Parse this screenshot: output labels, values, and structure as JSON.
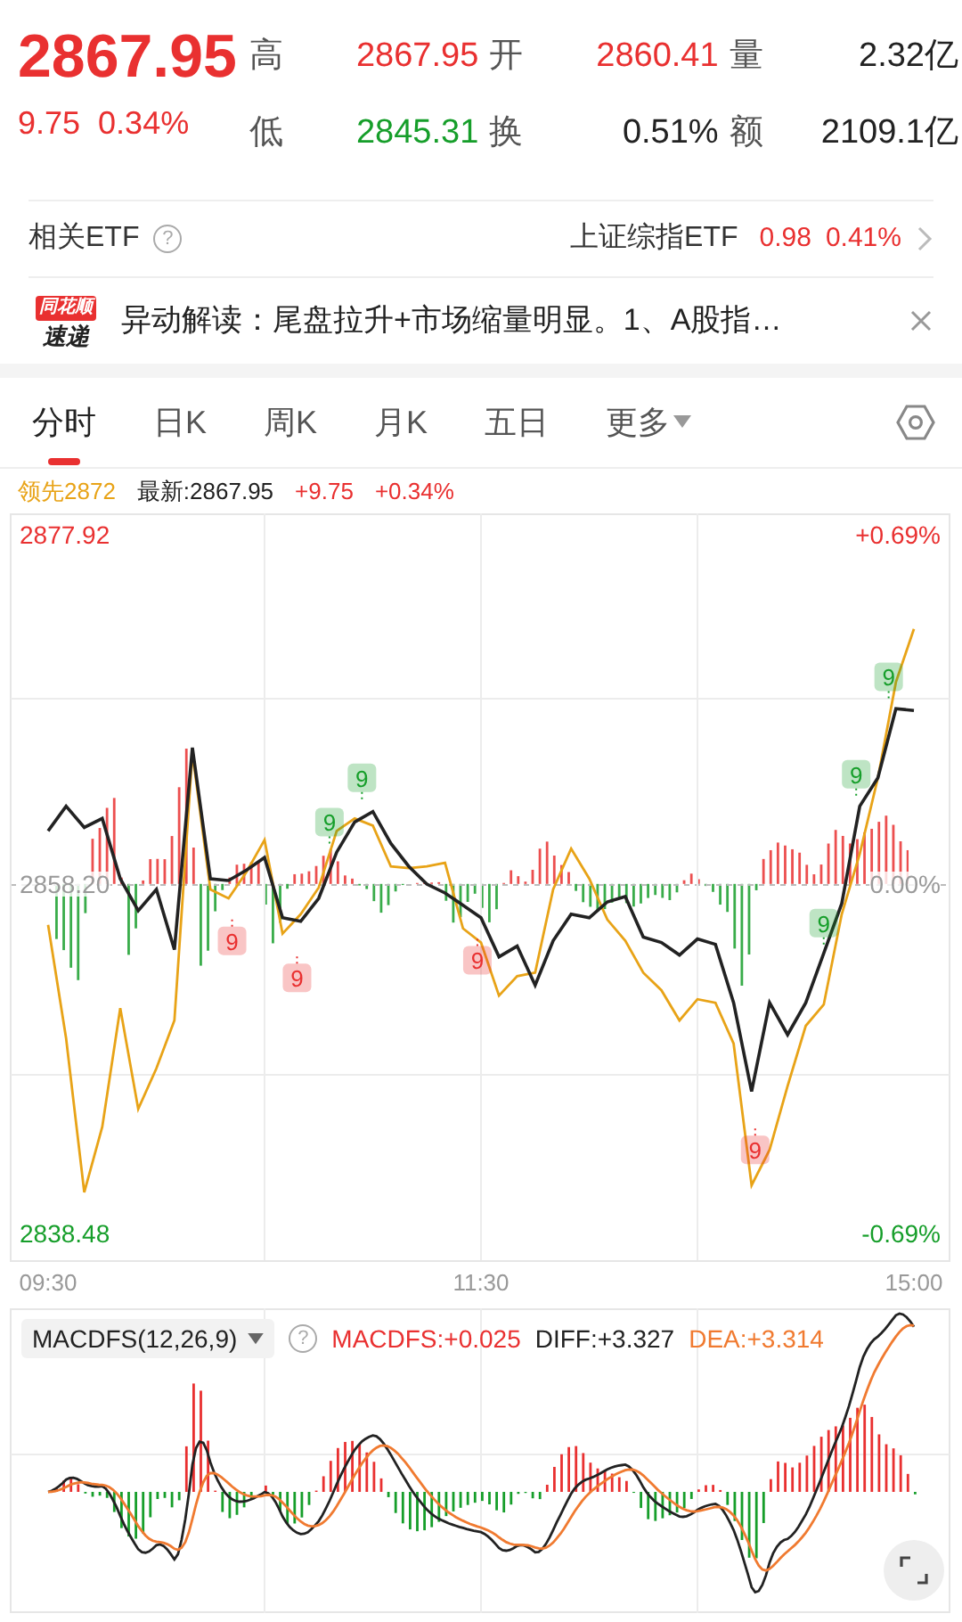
{
  "quote": {
    "price": "2867.95",
    "change": "9.75",
    "change_pct": "0.34%",
    "color": "#e93030",
    "stats": [
      {
        "label": "高",
        "value": "2867.95",
        "color": "#e93030"
      },
      {
        "label": "开",
        "value": "2860.41",
        "color": "#e93030"
      },
      {
        "label": "量",
        "value": "2.32亿",
        "color": "#222222"
      },
      {
        "label": "低",
        "value": "2845.31",
        "color": "#169e2a"
      },
      {
        "label": "换",
        "value": "0.51%",
        "color": "#222222"
      },
      {
        "label": "额",
        "value": "2109.1亿",
        "color": "#222222"
      }
    ]
  },
  "etf": {
    "label": "相关ETF",
    "help": "?",
    "name": "上证综指ETF",
    "price": "0.98",
    "change_pct": "0.41%"
  },
  "news": {
    "logo_top": "同花顺",
    "logo_bottom": "速递",
    "text": "异动解读：尾盘拉升+市场缩量明显。1、A股指…"
  },
  "tabs": [
    {
      "label": "分时",
      "selected": true
    },
    {
      "label": "日K",
      "selected": false
    },
    {
      "label": "周K",
      "selected": false
    },
    {
      "label": "月K",
      "selected": false
    },
    {
      "label": "五日",
      "selected": false
    },
    {
      "label": "更多",
      "selected": false,
      "kind": "dropdown"
    }
  ],
  "legend": {
    "lead_value": "2872",
    "latest_value": ":2867.95",
    "change": "+9.75",
    "change_pct": "+0.34%"
  },
  "chart": {
    "percent_labels": [
      "+0.69%",
      "0.00%",
      "-0.69%"
    ],
    "chart_data": {
      "type": "line",
      "categories": [
        "09:30",
        null,
        null,
        null,
        null,
        null,
        null,
        null,
        null,
        null,
        null,
        null,
        null,
        null,
        null,
        null,
        null,
        null,
        null,
        null,
        null,
        null,
        null,
        null,
        "11:30",
        null,
        null,
        null,
        null,
        null,
        null,
        null,
        null,
        null,
        null,
        null,
        null,
        null,
        null,
        null,
        null,
        null,
        null,
        null,
        null,
        null,
        null,
        null,
        "15:00"
      ],
      "ylim": [
        2836.92,
        2879.08
      ],
      "grid": true,
      "yticks": [
        {
          "value": 2877.92,
          "label": "2877.92"
        },
        {
          "value": 2858.2,
          "label": "2858.20"
        },
        {
          "value": 2838.48,
          "label": "2838.48"
        }
      ],
      "series": [
        {
          "name": "最新",
          "color": "#222222",
          "values": [
            2861.2,
            2862.6,
            2861.4,
            2861.9,
            2858.5,
            2856.7,
            2857.9,
            2854.5,
            2865.9,
            2858.5,
            2858.4,
            2859.0,
            2859.7,
            2856.3,
            2856.1,
            2857.4,
            2860.0,
            2861.7,
            2862.3,
            2860.5,
            2859.2,
            2858.2,
            2857.7,
            2857.0,
            2856.3,
            2854.1,
            2854.7,
            2852.5,
            2855.0,
            2856.5,
            2856.3,
            2857.2,
            2857.5,
            2855.2,
            2854.9,
            2854.2,
            2855.1,
            2854.8,
            2851.5,
            2846.5,
            2851.5,
            2849.7,
            2851.5,
            2854.3,
            2857.1,
            2862.6,
            2864.2,
            2868.1,
            2868.0
          ]
        },
        {
          "name": "领先",
          "color": "#e8a317",
          "values": [
            2855.9,
            2849.5,
            2840.8,
            2844.5,
            2851.2,
            2845.5,
            2847.8,
            2850.5,
            2865.6,
            2857.9,
            2857.4,
            2858.9,
            2860.7,
            2855.4,
            2856.5,
            2858.0,
            2861.2,
            2861.9,
            2861.5,
            2859.2,
            2859.1,
            2859.2,
            2859.4,
            2855.7,
            2854.9,
            2851.9,
            2853.0,
            2853.2,
            2857.9,
            2860.2,
            2858.5,
            2856.2,
            2855.0,
            2853.2,
            2852.2,
            2850.5,
            2851.7,
            2851.5,
            2849.2,
            2841.2,
            2843.2,
            2846.8,
            2850.2,
            2851.4,
            2856.5,
            2859.9,
            2864.2,
            2869.6,
            2872.6
          ]
        }
      ],
      "annotations": [
        "9",
        "9",
        "9",
        "9",
        "9",
        "9",
        "9",
        "9",
        "9"
      ]
    }
  },
  "macd": {
    "selector": "MACDFS(12,26,9)",
    "help": "?",
    "values": [
      {
        "text": "MACDFS:+0.025",
        "color": "#e93030"
      },
      {
        "text": "DIFF:+3.327",
        "color": "#222222"
      },
      {
        "text": "DEA:+3.314",
        "color": "#f07a30"
      }
    ]
  }
}
